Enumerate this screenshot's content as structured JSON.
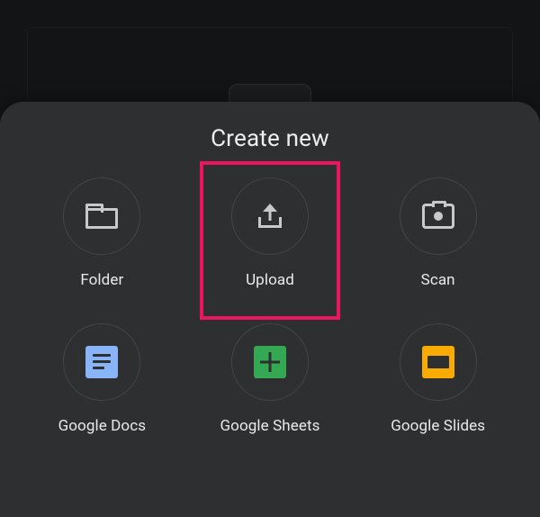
{
  "sheet": {
    "title": "Create new",
    "highlighted": "upload",
    "items": [
      {
        "id": "folder",
        "label": "Folder",
        "icon": "folder-icon"
      },
      {
        "id": "upload",
        "label": "Upload",
        "icon": "upload-icon"
      },
      {
        "id": "scan",
        "label": "Scan",
        "icon": "camera-icon"
      },
      {
        "id": "docs",
        "label": "Google Docs",
        "icon": "docs-icon"
      },
      {
        "id": "sheets",
        "label": "Google Sheets",
        "icon": "sheets-icon"
      },
      {
        "id": "slides",
        "label": "Google Slides",
        "icon": "slides-icon"
      }
    ]
  }
}
